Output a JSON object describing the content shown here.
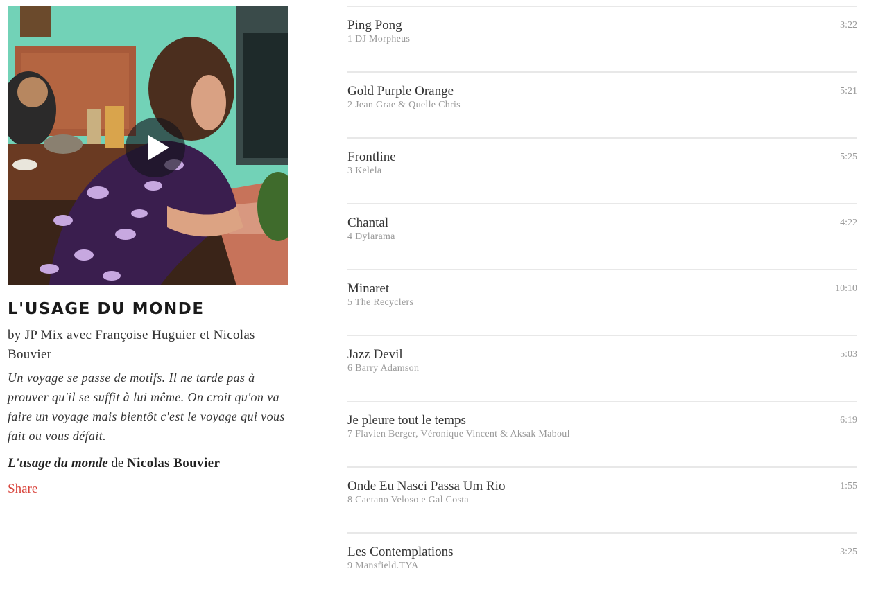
{
  "mix": {
    "title": "L'USAGE DU MONDE",
    "byline": "by JP Mix avec Françoise Huguier et Nicolas Bouvier",
    "description": "Un voyage se passe de motifs. Il ne tarde pas à prouver qu'il se suffit à lui même. On croit qu'on va faire un voyage mais bientôt c'est le voyage qui vous fait ou vous défait.",
    "credit_book": "L'usage du monde",
    "credit_de": "de",
    "credit_author": "Nicolas Bouvier",
    "share_label": "Share"
  },
  "tracks": [
    {
      "name": "Ping Pong",
      "subtitle": "1 DJ Morpheus",
      "duration": "3:22"
    },
    {
      "name": "Gold Purple Orange",
      "subtitle": "2 Jean Grae & Quelle Chris",
      "duration": "5:21"
    },
    {
      "name": "Frontline",
      "subtitle": "3 Kelela",
      "duration": "5:25"
    },
    {
      "name": "Chantal",
      "subtitle": "4 Dylarama",
      "duration": "4:22"
    },
    {
      "name": "Minaret",
      "subtitle": "5 The Recyclers",
      "duration": "10:10"
    },
    {
      "name": "Jazz Devil",
      "subtitle": "6 Barry Adamson",
      "duration": "5:03"
    },
    {
      "name": "Je pleure tout le temps",
      "subtitle": "7 Flavien Berger, Véronique Vincent & Aksak Maboul",
      "duration": "6:19"
    },
    {
      "name": "Onde Eu Nasci Passa Um Rio",
      "subtitle": "8 Caetano Veloso e Gal Costa",
      "duration": "1:55"
    },
    {
      "name": "Les Contemplations",
      "subtitle": "9 Mansfield.TYA",
      "duration": "3:25"
    }
  ],
  "icons": {
    "play": "play-icon"
  },
  "colors": {
    "accent": "#d9463e",
    "divider": "#e8e8e8",
    "muted": "#999999"
  }
}
